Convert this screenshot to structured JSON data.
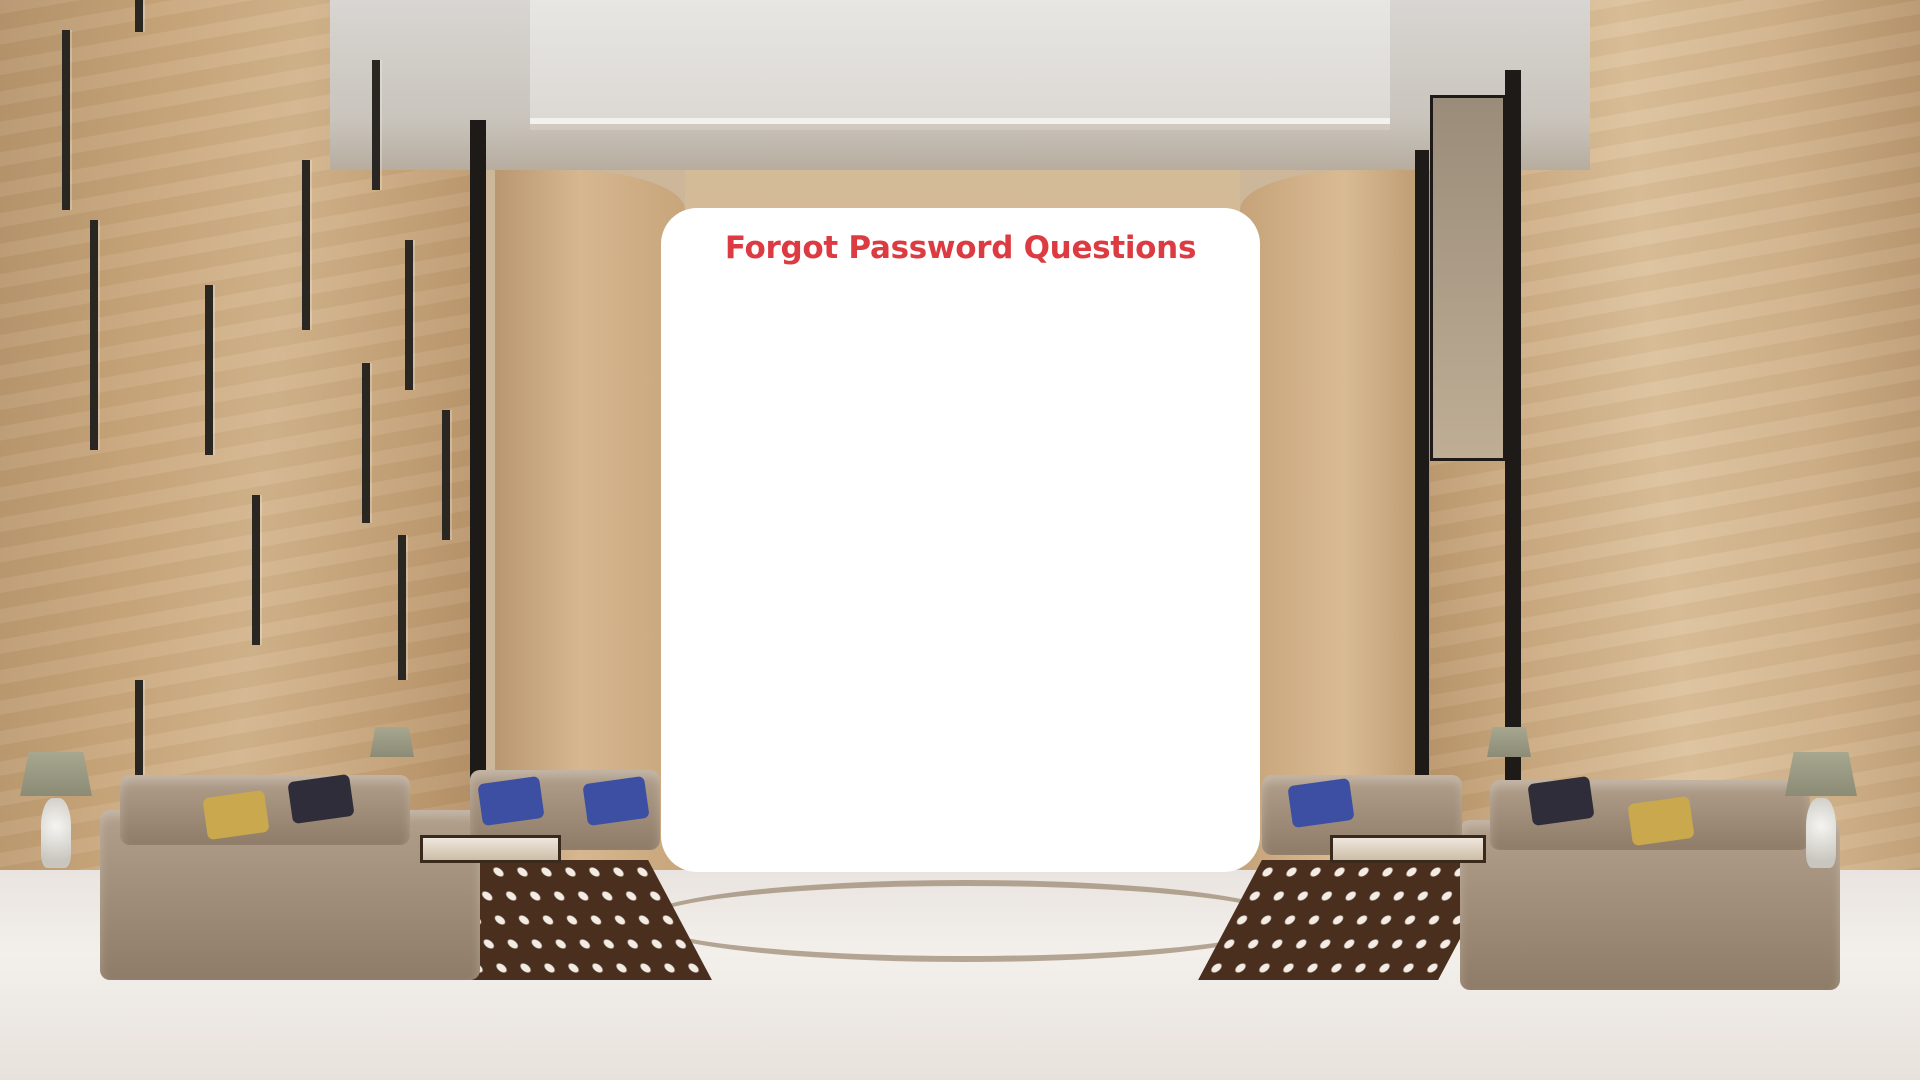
{
  "modal": {
    "title": "Forgot Password Questions"
  },
  "colors": {
    "title": "#dc3b41",
    "card": "#ffffff"
  },
  "background": {
    "icon": "hotel-lobby-background-image"
  }
}
